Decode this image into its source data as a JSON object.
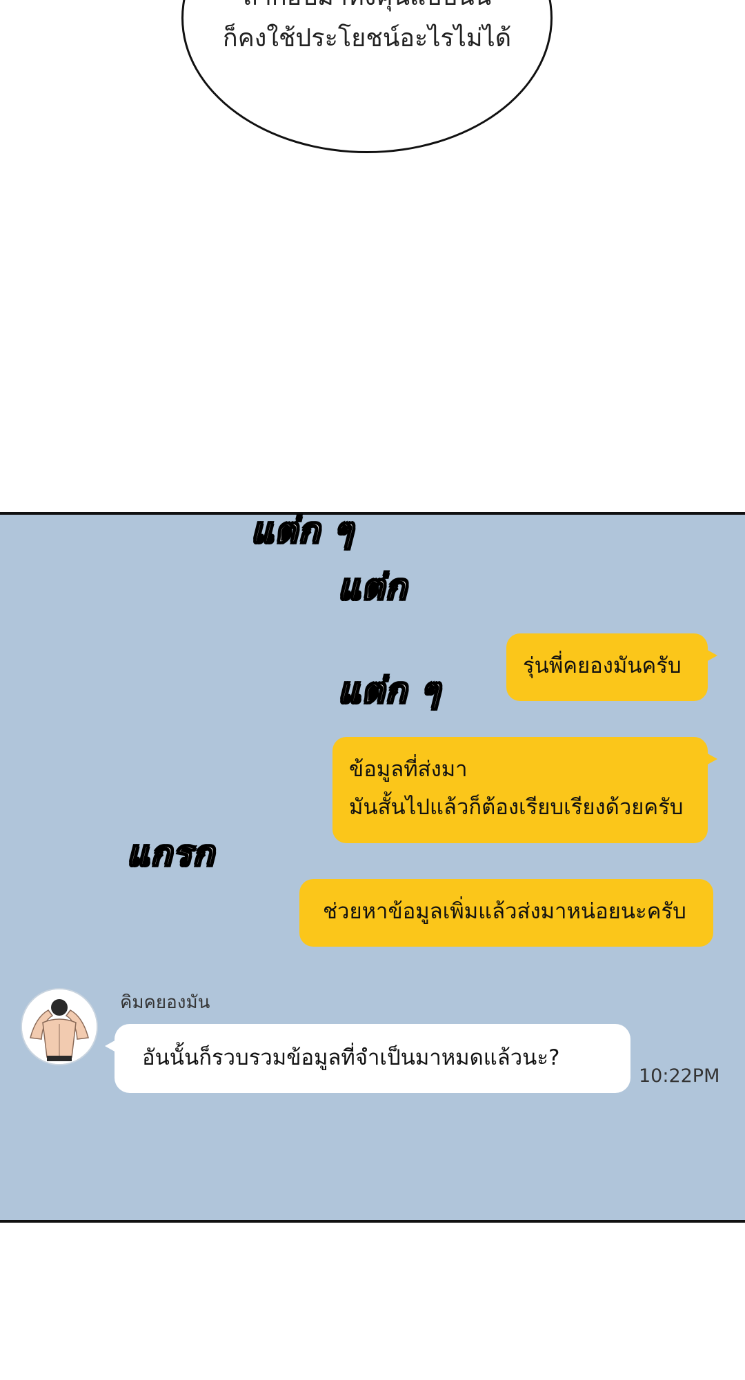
{
  "speech_bubble": {
    "line_1": "ถ้าก็อปมาทั้งคุ้นแบบนั้น",
    "line_2": "ก็คงใช้ประโยชน์อะไรไม่ได้"
  },
  "sound_effects": {
    "sfx_1": "แต่ก ๆ",
    "sfx_2": "แต่ก",
    "sfx_3": "แต่ก ๆ",
    "sfx_4": "แกรก"
  },
  "messages": {
    "sent_1": "รุ่นพี่คยองมันครับ",
    "sent_2_line_1": "ข้อมูลที่ส่งมา",
    "sent_2_line_2": "มันสั้นไปแล้วก็ต้องเรียบเรียงด้วยครับ",
    "sent_3": "ช่วยหาข้อมูลเพิ่มแล้วส่งมาหน่อยนะครับ",
    "received_sender": "คิมคยองมัน",
    "received_1": "อันนั้นก็รวบรวมข้อมูลที่จำเป็นมาหมดแล้วนะ?",
    "received_time": "10:22PM"
  },
  "colors": {
    "chat_background": "#b0c5da",
    "sent_bubble": "#fbc61a",
    "received_bubble": "#ffffff"
  }
}
